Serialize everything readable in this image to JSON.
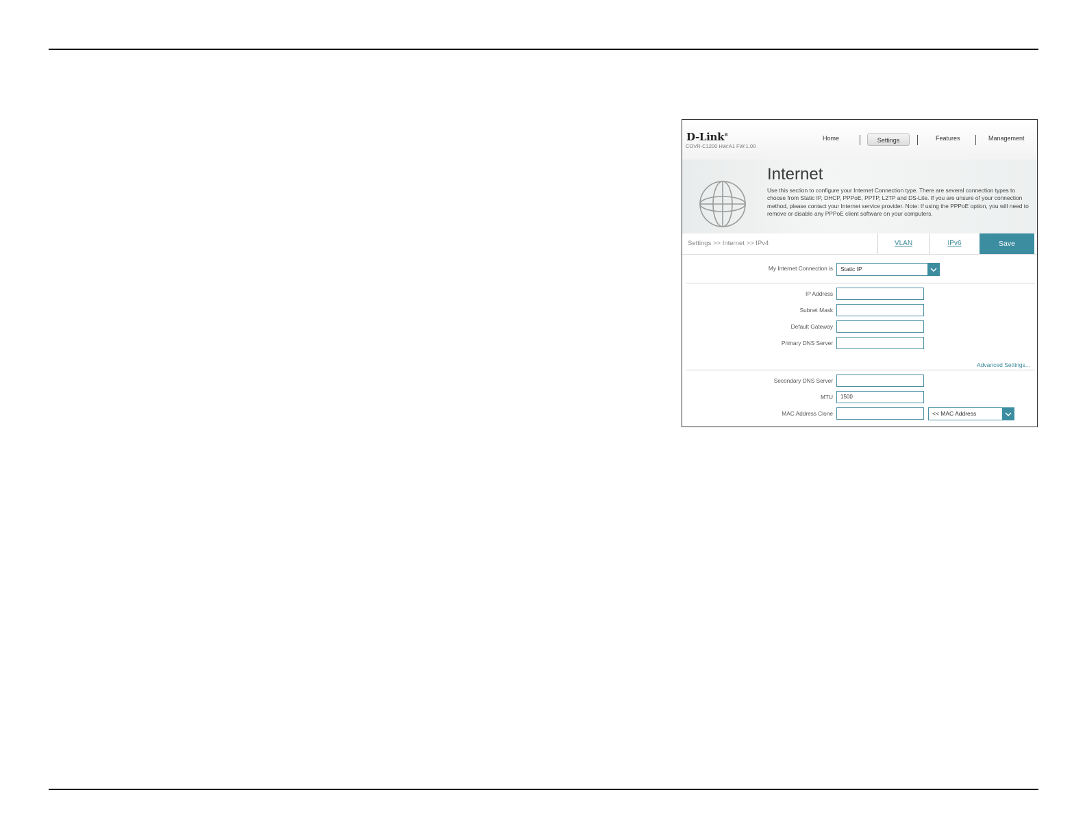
{
  "header": {
    "logo": "D-Link",
    "model": "COVR-C1200 HW:A1 FW:1.00",
    "nav": [
      "Home",
      "Settings",
      "Features",
      "Management"
    ],
    "active_nav": "Settings"
  },
  "banner": {
    "title": "Internet",
    "description": "Use this section to configure your Internet Connection type. There are several connection types to choose from Static IP, DHCP, PPPoE, PPTP, L2TP and DS-Lite. If you are unsure of your connection method, please contact your Internet service provider. Note: If using the PPPoE option, you will need to remove or disable any PPPoE client software on your computers."
  },
  "breadcrumb": "Settings >> Internet >> IPv4",
  "tabs": {
    "vlan": "VLAN",
    "ipv6": "IPv6",
    "save": "Save"
  },
  "form": {
    "connection_label": "My Internet Connection is",
    "connection_value": "Static IP",
    "ip_address_label": "IP Address",
    "ip_address_value": "",
    "subnet_mask_label": "Subnet Mask",
    "subnet_mask_value": "",
    "default_gateway_label": "Default Gateway",
    "default_gateway_value": "",
    "primary_dns_label": "Primary DNS Server",
    "primary_dns_value": "",
    "advanced_link": "Advanced Settings...",
    "secondary_dns_label": "Secondary DNS Server",
    "secondary_dns_value": "",
    "mtu_label": "MTU",
    "mtu_value": "1500",
    "mac_clone_label": "MAC Address Clone",
    "mac_clone_value": "",
    "mac_select_value": "<< MAC Address"
  },
  "colors": {
    "accent": "#3c8da0",
    "input_border": "#4a90a4"
  }
}
